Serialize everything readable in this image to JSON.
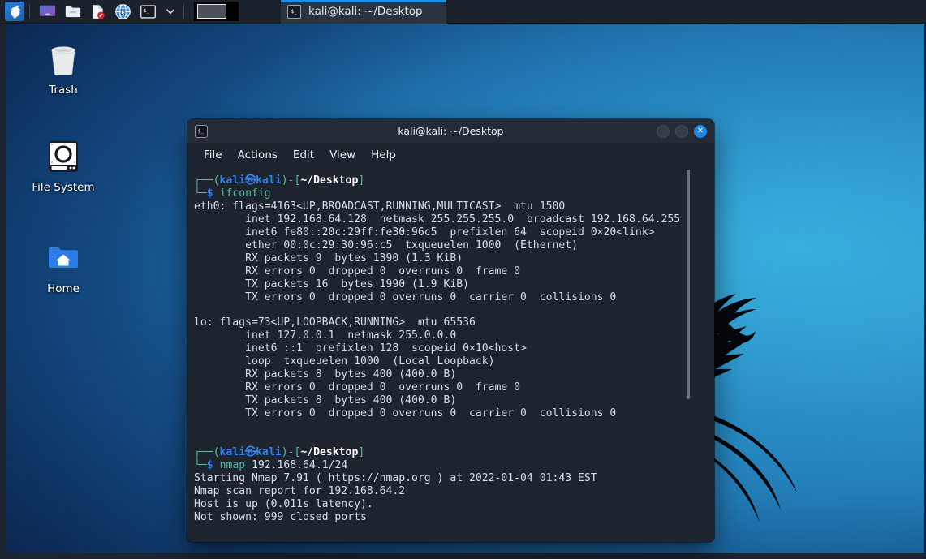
{
  "panel": {
    "kali_logo": "kali-dragon-logo",
    "launchers": [
      {
        "name": "show-desktop",
        "icon": "monitor-icon",
        "label": "Show Desktop"
      },
      {
        "name": "file-manager",
        "icon": "folder-icon",
        "label": "File Manager"
      },
      {
        "name": "kali-docs",
        "icon": "document-blocked-icon",
        "label": "Kali Docs"
      },
      {
        "name": "web-browser",
        "icon": "globe-icon",
        "label": "Web Browser"
      },
      {
        "name": "terminal-emulator",
        "icon": "terminal-icon",
        "label": "Terminal Emulator"
      }
    ],
    "chevron": "⌄",
    "workspace": {
      "name": "workspace-switcher",
      "count": 1
    },
    "task_button": {
      "label": "kali@kali: ~/Desktop",
      "icon": "terminal-icon",
      "active": true,
      "accent": "#1e8fe8"
    }
  },
  "desktop": {
    "icons": [
      {
        "name": "trash",
        "label": "Trash",
        "icon": "trash-icon"
      },
      {
        "name": "file-system",
        "label": "File System",
        "icon": "harddisk-icon"
      },
      {
        "name": "home",
        "label": "Home",
        "icon": "home-folder-icon"
      }
    ],
    "wallpaper": {
      "name": "kali-dragon-wallpaper",
      "base_color": "#1a5f9e",
      "accent_color": "#3aa7d4"
    }
  },
  "terminal": {
    "title": "kali@kali: ~/Desktop",
    "icon": "terminal-icon",
    "window_buttons": {
      "minimize": "–",
      "maximize": "□",
      "close": "✕",
      "close_color": "#1d88e8"
    },
    "menu": [
      "File",
      "Actions",
      "Edit",
      "View",
      "Help"
    ],
    "colors": {
      "background": "#1e242e",
      "foreground": "#d6dde5",
      "prompt_blue": "#2f7ff0",
      "prompt_green": "#4fbf9f",
      "command_green": "#57b79c"
    },
    "prompts": [
      {
        "user": "kali",
        "at_symbol": "㉿",
        "host": "kali",
        "path": "~/Desktop",
        "command": "ifconfig"
      },
      {
        "user": "kali",
        "at_symbol": "㉿",
        "host": "kali",
        "path": "~/Desktop",
        "command": "nmap 192.168.64.1/24"
      }
    ],
    "ifconfig_output": [
      "eth0: flags=4163<UP,BROADCAST,RUNNING,MULTICAST>  mtu 1500",
      "        inet 192.168.64.128  netmask 255.255.255.0  broadcast 192.168.64.255",
      "        inet6 fe80::20c:29ff:fe30:96c5  prefixlen 64  scopeid 0×20<link>",
      "        ether 00:0c:29:30:96:c5  txqueuelen 1000  (Ethernet)",
      "        RX packets 9  bytes 1390 (1.3 KiB)",
      "        RX errors 0  dropped 0  overruns 0  frame 0",
      "        TX packets 16  bytes 1990 (1.9 KiB)",
      "        TX errors 0  dropped 0 overruns 0  carrier 0  collisions 0",
      "",
      "lo: flags=73<UP,LOOPBACK,RUNNING>  mtu 65536",
      "        inet 127.0.0.1  netmask 255.0.0.0",
      "        inet6 ::1  prefixlen 128  scopeid 0×10<host>",
      "        loop  txqueuelen 1000  (Local Loopback)",
      "        RX packets 8  bytes 400 (400.0 B)",
      "        RX errors 0  dropped 0  overruns 0  frame 0",
      "        TX packets 8  bytes 400 (400.0 B)",
      "        TX errors 0  dropped 0 overruns 0  carrier 0  collisions 0",
      "",
      ""
    ],
    "nmap_output": [
      "Starting Nmap 7.91 ( https://nmap.org ) at 2022-01-04 01:43 EST",
      "Nmap scan report for 192.168.64.2",
      "Host is up (0.011s latency).",
      "Not shown: 999 closed ports"
    ],
    "scrollbar": {
      "name": "terminal-scrollbar"
    }
  }
}
